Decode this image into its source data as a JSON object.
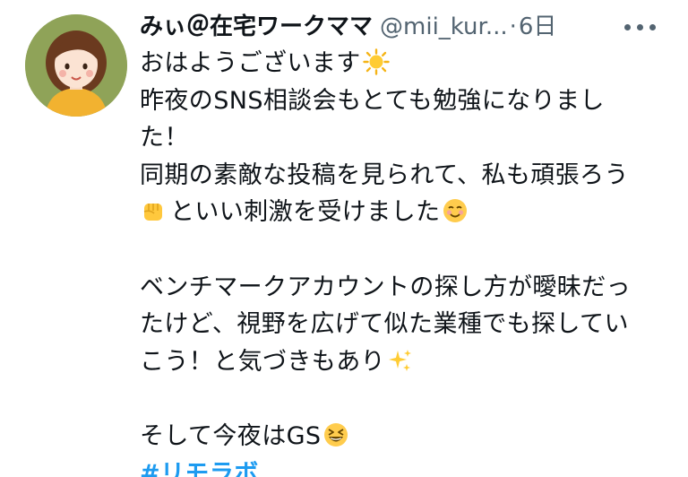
{
  "colors": {
    "text": "#0f1419",
    "secondary": "#536471",
    "link": "#1d9bf0",
    "avatar_bg": "#8fa358"
  },
  "tweet": {
    "author": {
      "display_name": "みぃ＠在宅ワークママ",
      "handle": "@mii_kur...",
      "separator": "·",
      "time": "6日"
    },
    "more_icon": "more-horizontal-icon",
    "body": {
      "line1": "おはようございます",
      "line1_emoji": "sun-emoji",
      "line2": "昨夜のSNS相談会もとても勉強になりまし",
      "line3": "た！",
      "line4": "同期の素敵な投稿を見られて、私も頑張ろう",
      "line5_emoji": "raised-fist-emoji",
      "line5": "といい刺激を受けました",
      "line5_end_emoji": "smiling-face-emoji",
      "line6": "ベンチマークアカウントの探し方が曖昧だっ",
      "line7": "たけど、視野を広げて似た業種でも探してい",
      "line8": "こう！と気づきもあり",
      "line8_emoji": "sparkles-emoji",
      "line9": "そして今夜はGS",
      "line9_emoji": "grinning-squinting-face-emoji",
      "hashtag": "#リモラボ"
    }
  }
}
